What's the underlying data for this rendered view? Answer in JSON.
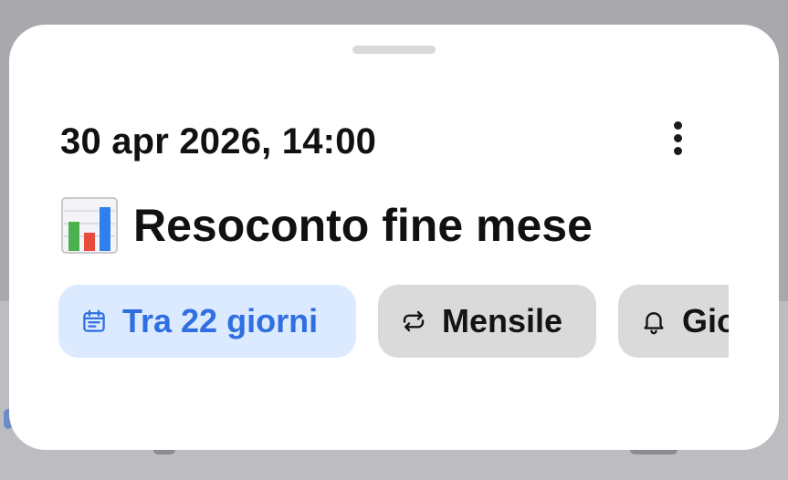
{
  "background": {
    "color": "#a9a9ad"
  },
  "sheet": {
    "datetime": "30 apr 2026, 14:00",
    "more_icon": "more-vertical-icon",
    "title_icon": "bar-chart-emoji",
    "title": "Resoconto fine mese",
    "chips": [
      {
        "icon": "calendar-icon",
        "label": "Tra 22 giorni",
        "color": "#2f6fe0",
        "background": "#dceaff"
      },
      {
        "icon": "repeat-icon",
        "label": "Mensile",
        "color": "#141414",
        "background": "#dadadb"
      },
      {
        "icon": "bell-icon",
        "label": "Gio",
        "color": "#141414",
        "background": "#dadadb"
      }
    ]
  }
}
